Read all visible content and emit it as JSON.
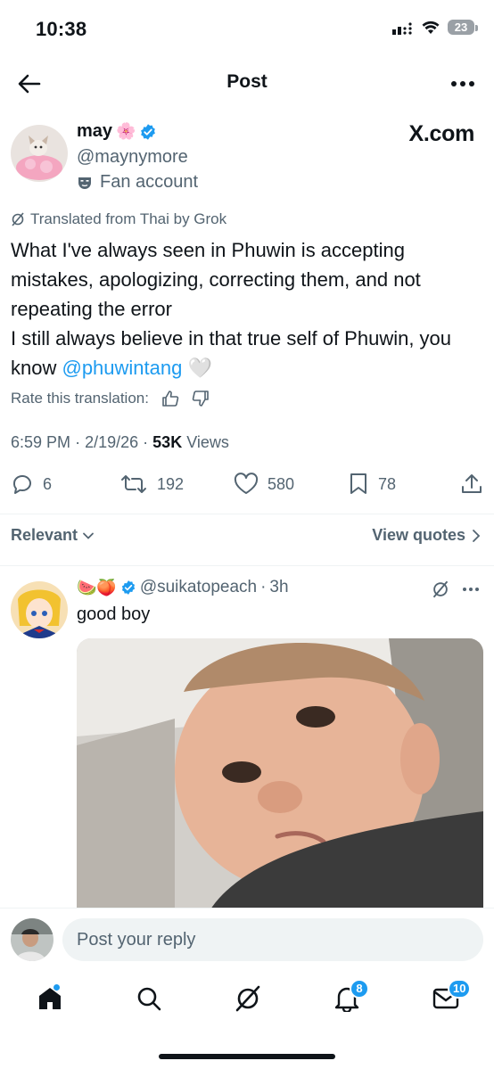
{
  "status": {
    "time": "10:38",
    "battery": "23"
  },
  "header": {
    "title": "Post"
  },
  "tweet": {
    "display_name": "may",
    "handle": "@maynymore",
    "label": "Fan account",
    "watermark": "X.com",
    "translated_note": "Translated from Thai by Grok",
    "text_lines": [
      "What I've always seen in Phuwin is accepting mistakes, apologizing, correcting them, and not repeating the error",
      "I still always believe in that true self of Phuwin, you know "
    ],
    "mention": "@phuwintang",
    "emoji": "🤍",
    "rate_label": "Rate this translation:",
    "time": "6:59 PM",
    "date": "2/19/26",
    "views_count": "53K",
    "views_label": "Views",
    "replies": "6",
    "reposts": "192",
    "likes": "580",
    "bookmarks": "78"
  },
  "sort": {
    "relevant_label": "Relevant",
    "quotes_label": "View quotes"
  },
  "reply": {
    "emojis": "🍉🍑",
    "handle": "@suikatopeach",
    "sep": "·",
    "time": "3h",
    "text": "good boy"
  },
  "composer": {
    "placeholder": "Post your reply"
  },
  "tabs": {
    "notifications_badge": "8",
    "messages_badge": "10"
  },
  "colors": {
    "accent": "#1d9bf0",
    "text": "#0f1419",
    "muted": "#536471",
    "divider": "#eff3f4"
  },
  "icons": [
    "back-arrow-icon",
    "more-icon",
    "verified-icon",
    "fan-mask-icon",
    "grok-icon",
    "thumbs-up-icon",
    "thumbs-down-icon",
    "reply-icon",
    "repost-icon",
    "like-icon",
    "bookmark-icon",
    "share-icon",
    "chevron-down-icon",
    "chevron-right-icon",
    "home-icon",
    "search-icon",
    "grok-tab-icon",
    "bell-icon",
    "mail-icon"
  ]
}
